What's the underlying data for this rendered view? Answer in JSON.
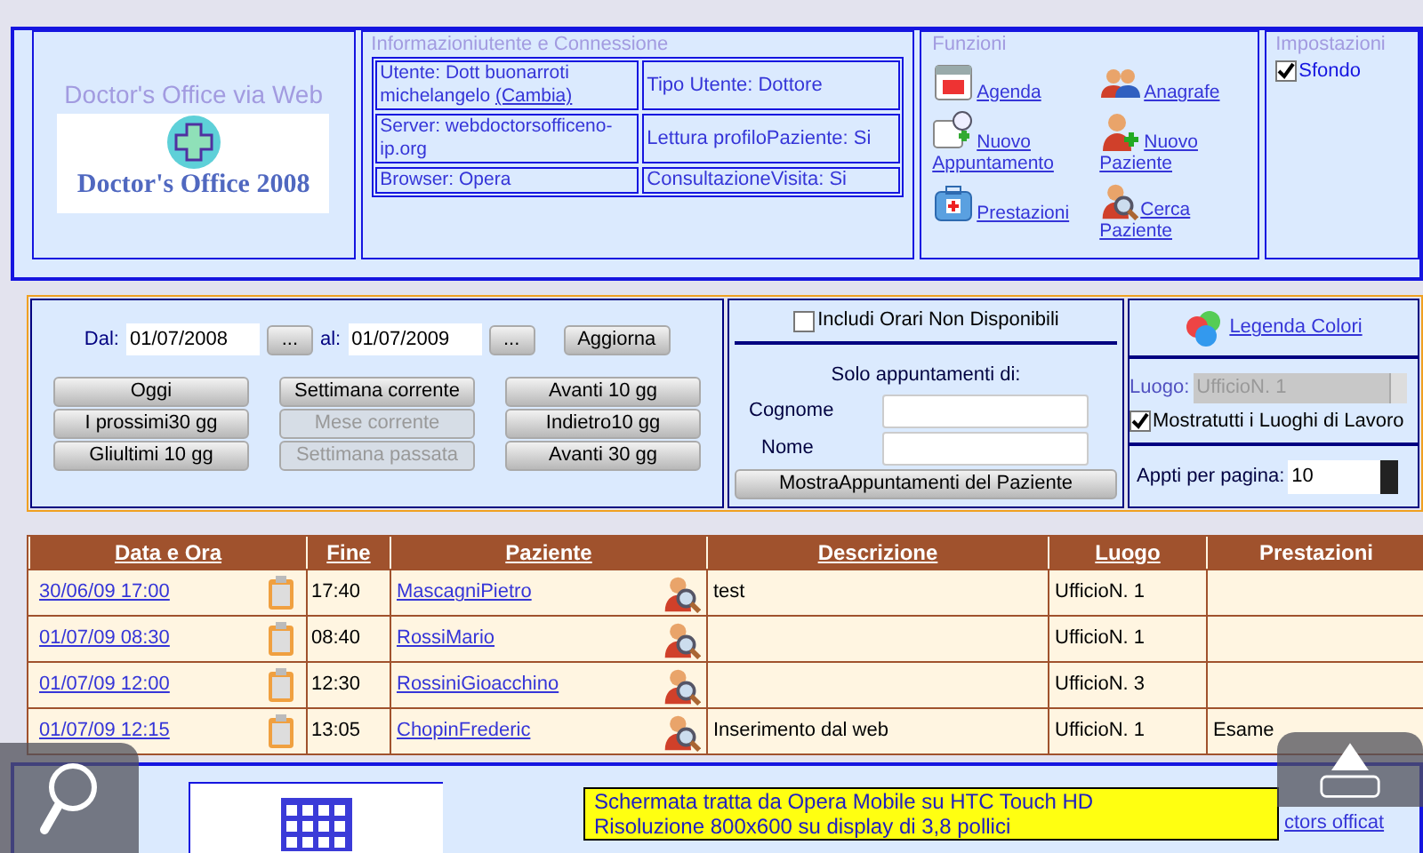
{
  "logo": {
    "title": "Doctor's Office via Web",
    "wordmark": "Doctor's Office 2008"
  },
  "info": {
    "title": "Informazioniutente e Connessione",
    "rows": [
      {
        "left": "Utente: Dott buonarroti michelangelo",
        "left_link": "(Cambia)",
        "right": "Tipo Utente: Dottore"
      },
      {
        "left": "Server: webdoctorsofficeno-ip.org",
        "right": "Lettura profiloPaziente: Si"
      },
      {
        "left": "Browser: Opera",
        "right": "ConsultazioneVisita: Si"
      }
    ]
  },
  "functions": {
    "title": "Funzioni",
    "items": [
      {
        "kind": "calendar",
        "label": "Agenda"
      },
      {
        "kind": "people",
        "label": "Anagrafe"
      },
      {
        "kind": "calendar-add",
        "label": "Nuovo Appuntamento"
      },
      {
        "kind": "person-add",
        "label": "Nuovo Paziente"
      },
      {
        "kind": "medkit",
        "label": "Prestazioni"
      },
      {
        "kind": "person-search",
        "label": "Cerca Paziente"
      }
    ]
  },
  "settings": {
    "title": "Impostazioni",
    "options": [
      {
        "label": "Sfondo",
        "checked": true
      }
    ]
  },
  "filters": {
    "from_label": "Dal:",
    "from": "01/07/2008",
    "from_picker": "...",
    "to_label": "al:",
    "to": "01/07/2009",
    "to_picker": "...",
    "refresh": "Aggiorna",
    "ranges": [
      {
        "label": "Oggi",
        "disabled": false
      },
      {
        "label": "Settimana corrente",
        "disabled": false
      },
      {
        "label": "Avanti 10 gg",
        "disabled": false
      },
      {
        "label": "I prossimi30 gg",
        "disabled": false
      },
      {
        "label": "Mese corrente",
        "disabled": true
      },
      {
        "label": "Indietro10 gg",
        "disabled": false
      },
      {
        "label": "Gliultimi 10 gg",
        "disabled": false
      },
      {
        "label": "Settimana passata",
        "disabled": true
      },
      {
        "label": "Avanti 30 gg",
        "disabled": false
      }
    ]
  },
  "patient_filter": {
    "unavailable": {
      "label": "Includi Orari Non Disponibili",
      "checked": false
    },
    "title": "Solo appuntamenti di:",
    "surname_label": "Cognome",
    "name_label": "Nome",
    "button": "MostraAppuntamenti del Paziente"
  },
  "options": {
    "legend": "Legenda Colori",
    "place_label": "Luogo:",
    "place": "UfficioN. 1",
    "place_disabled": true,
    "all_places": {
      "label": "Mostratutti i Luoghi di Lavoro",
      "checked": true
    },
    "per_page_label": "Appti per pagina:",
    "per_page": "10"
  },
  "table": {
    "columns": [
      {
        "label": "Data e Ora",
        "link": true
      },
      {
        "label": "Fine",
        "link": true
      },
      {
        "label": "Paziente",
        "link": true
      },
      {
        "label": "Descrizione",
        "link": true
      },
      {
        "label": "Luogo",
        "link": true
      },
      {
        "label": "Prestazioni",
        "link": false
      }
    ],
    "rows": [
      {
        "start": "30/06/09 17:00",
        "end": "17:40",
        "patient": "MascagniPietro",
        "description": "test",
        "place": "UfficioN. 1",
        "services": ""
      },
      {
        "start": "01/07/09 08:30",
        "end": "08:40",
        "patient": "RossiMario",
        "description": "",
        "place": "UfficioN. 1",
        "services": ""
      },
      {
        "start": "01/07/09 12:00",
        "end": "12:30",
        "patient": "RossiniGioacchino",
        "description": "",
        "place": "UfficioN. 3",
        "services": ""
      },
      {
        "start": "01/07/09 12:15",
        "end": "13:05",
        "patient": "ChopinFrederic",
        "description": "Inserimento dal web",
        "place": "UfficioN. 1",
        "services": "Esame"
      }
    ]
  },
  "footer": {
    "caption": [
      "Schermata tratta da Opera Mobile su HTC Touch HD",
      "Risoluzione 800x600 su display di 3,8 pollici"
    ],
    "link": "ctors officat"
  }
}
